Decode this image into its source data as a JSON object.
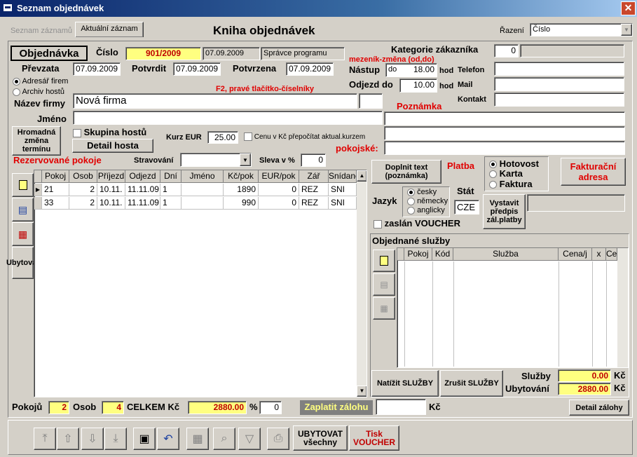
{
  "window": {
    "title": "Seznam objednávek"
  },
  "tabs": [
    {
      "label": "Seznam záznamů",
      "active": false
    },
    {
      "label": "Aktuální záznam",
      "active": true
    }
  ],
  "heading": "Kniha objednávek",
  "sort": {
    "label": "Řazení",
    "value": "Číslo"
  },
  "order": {
    "box_label": "Objednávka",
    "number_label": "Číslo",
    "number": "901/2009",
    "created_date": "07.09.2009",
    "created_by": "Správce programu",
    "taken_label": "Převzata",
    "taken_date": "07.09.2009",
    "confirm_label": "Potvrdit",
    "confirm_date": "07.09.2009",
    "confirmed_label": "Potvrzena",
    "confirmed_date": "07.09.2009"
  },
  "customer_category": {
    "label": "Kategorie zákazníka",
    "value": "0"
  },
  "stay": {
    "hint": "mezeník-změna (od,do)",
    "arrival_label": "Nástup",
    "arrival_prefix": "do",
    "arrival_time": "18.00",
    "departure_label": "Odjezd do",
    "departure_time": "10.00",
    "unit": "hod"
  },
  "contacts": {
    "phone_label": "Telefon",
    "mail_label": "Mail",
    "contact_label": "Kontakt"
  },
  "source": {
    "options": [
      {
        "label": "Adresář firem",
        "selected": true
      },
      {
        "label": "Archiv hostů",
        "selected": false
      }
    ],
    "hint": "F2, pravé tlačítko-číselníky"
  },
  "company": {
    "label": "Název firmy",
    "value": "Nová firma"
  },
  "name": {
    "label": "Jméno",
    "value": ""
  },
  "note_label": "Poznámka",
  "room_note_label": "pokojské:",
  "group": {
    "mass_change_label": "Hromadná změna termínu",
    "group_label": "Skupina hostů",
    "detail_label": "Detail hosta",
    "rate_label": "Kurz EUR",
    "rate_value": "25.00",
    "recalc_label": "Cenu v Kč přepočítat aktual.kurzem"
  },
  "rooms": {
    "title": "Rezervované pokoje",
    "board_label": "Stravování",
    "discount_label": "Sleva v %",
    "discount_value": "0",
    "columns": [
      "Pokoj",
      "Osob",
      "Příjezd",
      "Odjezd",
      "Dní",
      "Jméno",
      "Kč/pok",
      "EUR/pok",
      "Zář",
      "Snídaně"
    ],
    "rows": [
      [
        "21",
        "2",
        "10.11.",
        "11.11.09",
        "1",
        "",
        "1890",
        "0",
        "REZ",
        "SNI"
      ],
      [
        "33",
        "2",
        "10.11.",
        "11.11.09",
        "1",
        "",
        "990",
        "0",
        "REZ",
        "SNI"
      ]
    ],
    "accommodate_label": "Ubytovat"
  },
  "payment": {
    "fill_text_label": "Doplnit text (poznámka)",
    "label": "Platba",
    "options": [
      {
        "label": "Hotovost",
        "selected": true
      },
      {
        "label": "Karta",
        "selected": false
      },
      {
        "label": "Faktura",
        "selected": false
      }
    ],
    "invoice_address_label": "Fakturační adresa"
  },
  "language": {
    "label": "Jazyk",
    "options": [
      {
        "label": "česky",
        "selected": true
      },
      {
        "label": "německy",
        "selected": false
      },
      {
        "label": "anglicky",
        "selected": false
      }
    ],
    "state_label": "Stát",
    "state_value": "CZE",
    "voucher_sent_label": "zaslán VOUCHER",
    "deposit_button_label": "Vystavit předpis zál.platby"
  },
  "services": {
    "title": "Objednané služby",
    "columns": [
      "Pokoj",
      "Kód",
      "Služba",
      "Cena/j",
      "x",
      "Cena"
    ],
    "load_label": "Natížit SLUŽBY",
    "cancel_label": "Zrušit SLUŽBY",
    "services_sum_label": "Služby",
    "services_sum": "0.00",
    "accommodation_sum_label": "Ubytování",
    "accommodation_sum": "2880.00",
    "currency": "Kč"
  },
  "footer": {
    "rooms_label": "Pokojů",
    "rooms_value": "2",
    "persons_label": "Osob",
    "persons_value": "4",
    "total_label": "CELKEM Kč",
    "total_value": "2880.00",
    "percent_label": "%",
    "percent_value": "0",
    "pay_deposit_label": "Zaplatit zálohu",
    "currency": "Kč",
    "deposit_detail_label": "Detail zálohy"
  },
  "toolbar": {
    "accommodate_all_label": "UBYTOVAT všechny",
    "print_voucher_label": "Tisk VOUCHER"
  },
  "colors": {
    "accent_red": "#e00000",
    "highlight_yellow": "#ffff80",
    "title_blue": "#0a246a"
  }
}
